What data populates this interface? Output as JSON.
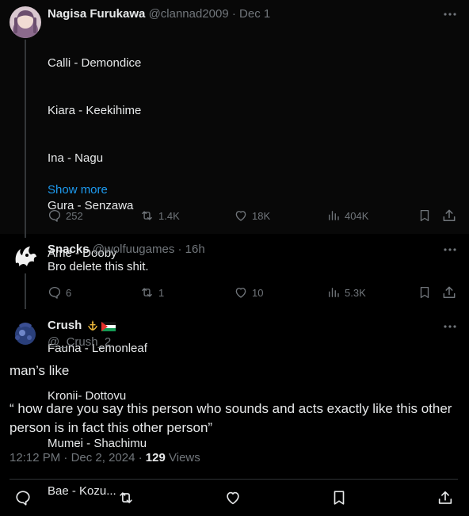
{
  "tweet1": {
    "name": "Nagisa Furukawa",
    "handle": "@clannad2009",
    "sep": "·",
    "time": "Dec 1",
    "lines": [
      "Calli - Demondice",
      "Kiara - Keekihime",
      "Ina - Nagu",
      "Gura - Senzawa",
      "Ame - Dooby",
      "",
      "Fauna - Lemonleaf",
      "Kronii- Dottovu",
      "Mumei - Shachimu",
      "Bae - Kozu..."
    ],
    "show_more": "Show more",
    "replies": "252",
    "reposts": "1.4K",
    "likes": "18K",
    "views": "404K"
  },
  "tweet2": {
    "name": "Snacks",
    "handle": "@wolfuugames",
    "sep": "·",
    "time": "16h",
    "text": "Bro delete this shit.",
    "replies": "6",
    "reposts": "1",
    "likes": "10",
    "views": "5.3K"
  },
  "main": {
    "name": "Crush",
    "handle": "@_Crush_2",
    "text_line1": "man’s like",
    "text_quote": "“ how dare you say this person who sounds and acts exactly like this other person is in fact this other person”",
    "time": "12:12 PM",
    "date": "Dec 2, 2024",
    "view_count": "129",
    "views_label": "Views"
  },
  "icons": {
    "more": "more-horizontal-icon",
    "reply": "reply-icon",
    "repost": "repost-icon",
    "like": "heart-icon",
    "views": "views-icon",
    "bookmark": "bookmark-icon",
    "share": "share-icon",
    "badge": "emblem-icon",
    "flag": "palestine-flag-icon"
  },
  "colors": {
    "background": "#000000",
    "text": "#e7e9ea",
    "muted": "#71767b",
    "link": "#1d9bf0",
    "divider": "#2f3336"
  }
}
